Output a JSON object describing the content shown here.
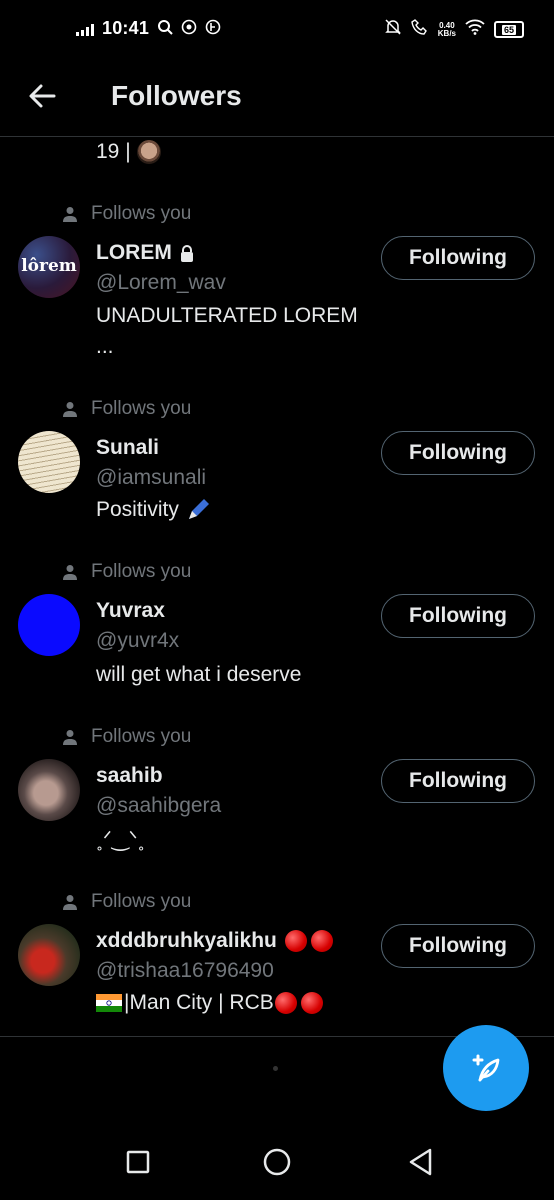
{
  "status_bar": {
    "time": "10:41",
    "speed_value": "0.40",
    "speed_unit": "KB/s",
    "battery": "65"
  },
  "header": {
    "title": "Followers"
  },
  "partial_bio": "19 |",
  "follows_you_label": "Follows you",
  "following_label": "Following",
  "followers": [
    {
      "name": "LOREM",
      "handle": "@Lorem_wav",
      "bio": "UNADULTERATED LOREM",
      "bio2": "...",
      "avatar_text": "lôrem",
      "locked": true
    },
    {
      "name": "Sunali",
      "handle": "@iamsunali",
      "bio": "Positivity"
    },
    {
      "name": "Yuvrax",
      "handle": "@yuvr4x",
      "bio": "will get what i deserve"
    },
    {
      "name": "saahib",
      "handle": "@saahibgera",
      "bio": "˳ᐟ‿ᐠ˳"
    },
    {
      "name": "xdddbruhkyalikhu",
      "handle": "@trishaa16796490",
      "bio": "|Man City | RCB"
    }
  ],
  "colors": {
    "accent": "#1d9bf0",
    "background": "#000000",
    "secondary_text": "#71767b"
  },
  "icons": [
    "back-arrow-icon",
    "lock-icon",
    "person-icon",
    "pen-icon",
    "compose-icon",
    "square-nav-icon",
    "circle-nav-icon",
    "triangle-nav-icon"
  ]
}
